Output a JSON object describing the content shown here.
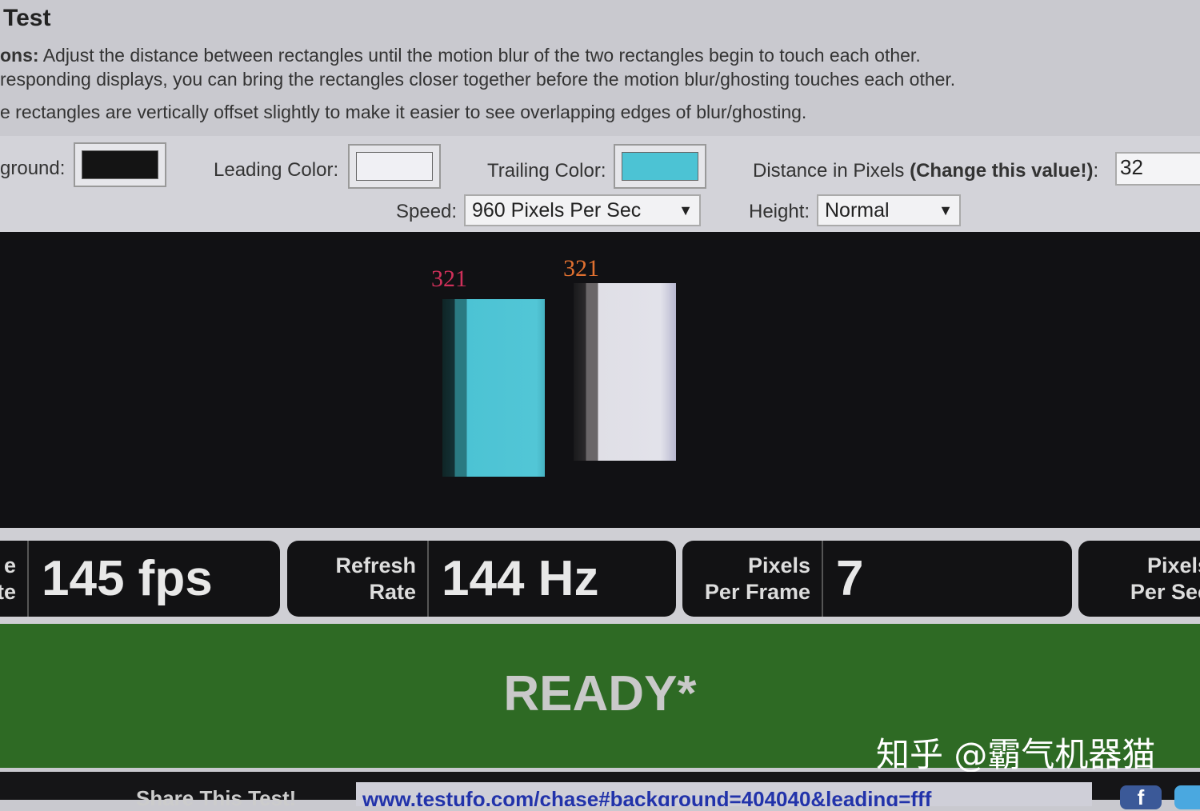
{
  "header": {
    "title": "Test",
    "instructions_label": "ons:",
    "instructions_line1": "Adjust the distance between rectangles until the motion blur of the two rectangles begin to touch each other.",
    "instructions_line2": "responding displays, you can bring the rectangles closer together before the motion blur/ghosting touches each other.",
    "instructions_line3": "e rectangles are vertically offset slightly to make it easier to see overlapping edges of blur/ghosting."
  },
  "controls": {
    "background_label": "ground:",
    "background_color": "#141414",
    "leading_label": "Leading Color:",
    "leading_color": "#f0f0f4",
    "trailing_label": "Trailing Color:",
    "trailing_color": "#4cc3d4",
    "distance_label": "Distance in Pixels",
    "distance_hint": "(Change this value!)",
    "distance_colon": ":",
    "distance_value": "32",
    "speed_label": "Speed:",
    "speed_value": "960 Pixels Per Sec",
    "height_label": "Height:",
    "height_value": "Normal",
    "dropdown_arrow": "▼"
  },
  "stage": {
    "left_number": "321",
    "right_number": "321",
    "left_number_color": "#d0305a",
    "right_number_color": "#e07030"
  },
  "stats": [
    {
      "label_line1": "e",
      "label_line2": "te",
      "value": "145 fps"
    },
    {
      "label_line1": "Refresh",
      "label_line2": "Rate",
      "value": "144 Hz"
    },
    {
      "label_line1": "Pixels",
      "label_line2": "Per Frame",
      "value": "7"
    },
    {
      "label_line1": "Pixels",
      "label_line2": "Per Sec",
      "value": ""
    }
  ],
  "status": {
    "text": "READY*",
    "color": "#2e6a24"
  },
  "share": {
    "label": "Share This Test!",
    "url": "www.testufo.com/chase#background=404040&leading=fff"
  },
  "watermark": "知乎 @霸气机器猫"
}
